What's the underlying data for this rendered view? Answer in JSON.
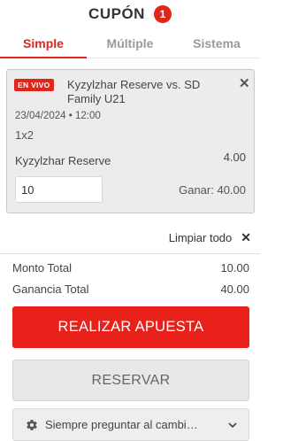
{
  "header": {
    "title": "CUPÓN",
    "count": "1"
  },
  "tabs": [
    {
      "label": "Simple",
      "active": true
    },
    {
      "label": "Múltiple",
      "active": false
    },
    {
      "label": "Sistema",
      "active": false
    }
  ],
  "bet": {
    "live_badge": "EN VIVO",
    "event": "Kyzylzhar Reserve vs. SD Family U21",
    "close_glyph": "✕",
    "date": "23/04/2024 • 12:00",
    "market": "1x2",
    "selection": "Kyzylzhar Reserve",
    "odds": "4.00",
    "stake": "10",
    "win": "Ganar: 40.00"
  },
  "clear": {
    "label": "Limpiar todo",
    "glyph": "✕"
  },
  "summary": {
    "total_label": "Monto Total",
    "total_value": "10.00",
    "gain_label": "Ganancia Total",
    "gain_value": "40.00"
  },
  "actions": {
    "place_label": "REALIZAR APUESTA",
    "reserve_label": "RESERVAR",
    "odds_pref_label": "Siempre preguntar al cambi…"
  },
  "colors": {
    "accent": "#e1251b",
    "card_bg": "#ececec"
  },
  "icons": {
    "settings": "gear-icon",
    "dropdown": "chevron-down-icon",
    "close": "close-icon"
  }
}
